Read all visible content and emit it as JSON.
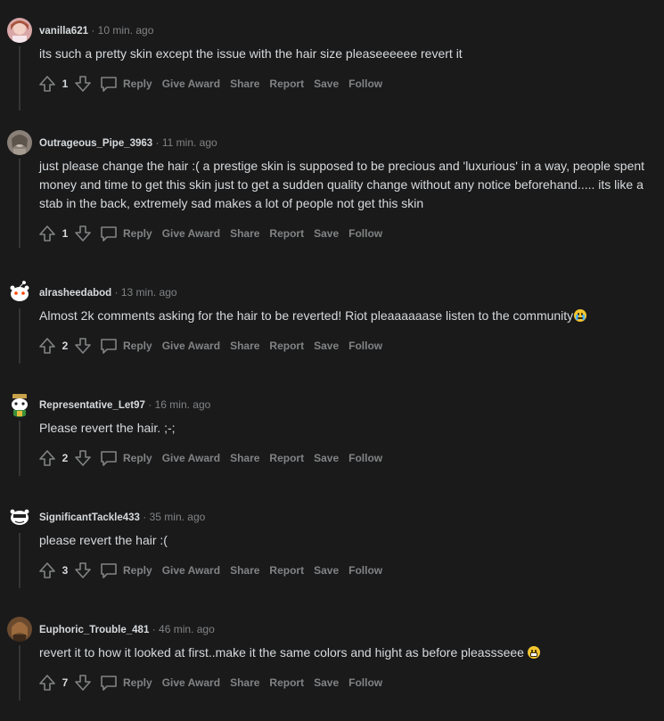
{
  "actions": {
    "reply": "Reply",
    "give_award": "Give Award",
    "share": "Share",
    "report": "Report",
    "save": "Save",
    "follow": "Follow"
  },
  "separator": "·",
  "comments": [
    {
      "username": "vanilla621",
      "timestamp": "10 min. ago",
      "text": "its such a pretty skin except the issue with the hair size pleaseeeeee revert it",
      "score": "1",
      "avatar": "photo-avatar-pink"
    },
    {
      "username": "Outrageous_Pipe_3963",
      "timestamp": "11 min. ago",
      "text": "just please change the hair :( a prestige skin is supposed to be precious and 'luxurious' in a way, people spent money and time to get this skin just to get a sudden quality change without any notice beforehand..... its like a stab in the back, extremely sad makes a lot of people not get this skin",
      "score": "1",
      "avatar": "photo-avatar-grey"
    },
    {
      "username": "alrasheedabod",
      "timestamp": "13 min. ago",
      "text": "Almost 2k comments asking for the hair to be reverted! Riot pleaaaaaase listen to the community",
      "emoji": "crying-face-emoji",
      "score": "2",
      "avatar": "snoo-avatar-white"
    },
    {
      "username": "Representative_Let97",
      "timestamp": "16 min. ago",
      "text": "Please revert the hair. ;-;",
      "score": "2",
      "avatar": "snoo-avatar-hat"
    },
    {
      "username": "SignificantTackle433",
      "timestamp": "35 min. ago",
      "text": "please revert the hair :(",
      "score": "3",
      "avatar": "snoo-avatar-dark"
    },
    {
      "username": "Euphoric_Trouble_481",
      "timestamp": "46 min. ago",
      "text": "revert it to how it looked at first..make it the same colors and hight as before pleassseee",
      "emoji": "grimacing-face-emoji",
      "score": "7",
      "avatar": "photo-avatar-brown"
    }
  ],
  "colors": {
    "background": "#1a1a1b",
    "text": "#d7dadc",
    "muted": "#818384",
    "thread_line": "#343536"
  }
}
